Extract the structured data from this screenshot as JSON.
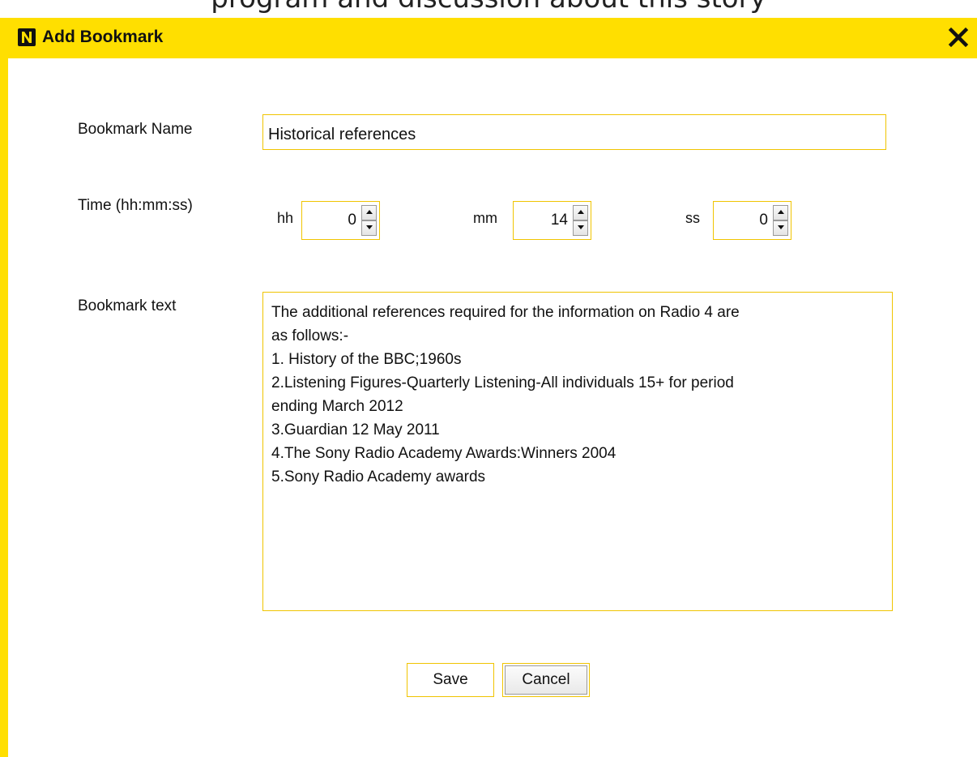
{
  "background_text": "program and discussion about this story",
  "dialog": {
    "title": "Add Bookmark",
    "close_icon": "close-icon",
    "logo_icon": "n-logo-icon"
  },
  "form": {
    "name_label": "Bookmark Name",
    "name_value": "Historical references",
    "time_label": "Time (hh:mm:ss)",
    "hh_label": "hh",
    "hh_value": "0",
    "mm_label": "mm",
    "mm_value": "14",
    "ss_label": "ss",
    "ss_value": "0",
    "text_label": "Bookmark text",
    "text_lines": [
      "The additional references required for the information on Radio 4 are",
      "as follows:-",
      "1. History of the BBC;1960s",
      "2.Listening Figures-Quarterly Listening-All individuals 15+ for period",
      "ending March 2012",
      "3.Guardian 12 May 2011",
      "4.The Sony Radio Academy Awards:Winners 2004",
      "5.Sony Radio Academy awards"
    ]
  },
  "buttons": {
    "save_label": "Save",
    "cancel_label": "Cancel"
  },
  "colors": {
    "accent": "#ffdf00",
    "field_border": "#f0c400"
  }
}
